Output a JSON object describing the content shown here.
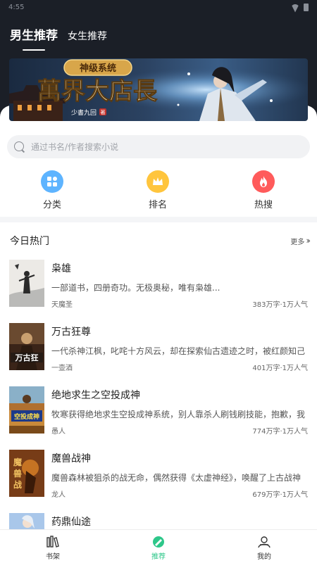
{
  "status_bar": {
    "time": "4:55"
  },
  "top_tabs": [
    {
      "label": "男生推荐",
      "active": true
    },
    {
      "label": "女生推荐",
      "active": false
    }
  ],
  "banner": {
    "badge": "神级系统",
    "title": "萬界大店長",
    "author_tag": "少書九回",
    "seal": "著"
  },
  "search": {
    "placeholder": "通过书名/作者搜索小说"
  },
  "quick_actions": [
    {
      "label": "分类",
      "icon": "category-icon",
      "color": "#5eb4ff"
    },
    {
      "label": "排名",
      "icon": "crown-icon",
      "color": "#ffc53d"
    },
    {
      "label": "热搜",
      "icon": "fire-icon",
      "color": "#ff5b5b"
    }
  ],
  "hot_section": {
    "title": "今日热门",
    "more_label": "更多"
  },
  "books": [
    {
      "title": "枭雄",
      "desc": "一部道书，四册奇功。无极奥秘，唯有枭雄...",
      "author": "天魔圣",
      "meta": "383万字·1万人气"
    },
    {
      "title": "万古狂尊",
      "desc": "一代杀神江枫，叱咤十方风云，却在探索仙古遗迹之时，被红颜知己",
      "author": "一壶酒",
      "meta": "401万字·1万人气"
    },
    {
      "title": "绝地求生之空投成神",
      "desc": "牧寒获得绝地求生空投成神系统，别人靠杀人刷钱刷技能，抱歉，我",
      "author": "愚人",
      "meta": "774万字·1万人气"
    },
    {
      "title": "魔兽战神",
      "desc": "魔兽森林被狙杀的战无命，偶然获得《太虚神经》，唤醒了上古战神",
      "author": "龙人",
      "meta": "679万字·1万人气"
    },
    {
      "title": "药鼎仙途",
      "desc": "",
      "author": "",
      "meta": ""
    }
  ],
  "bottom_nav": [
    {
      "label": "书架",
      "icon": "bookshelf-icon",
      "active": false
    },
    {
      "label": "推荐",
      "icon": "recommend-icon",
      "active": true
    },
    {
      "label": "我的",
      "icon": "profile-icon",
      "active": false
    }
  ],
  "colors": {
    "header_bg": "#1b1f27",
    "accent_green": "#2ec78a"
  }
}
